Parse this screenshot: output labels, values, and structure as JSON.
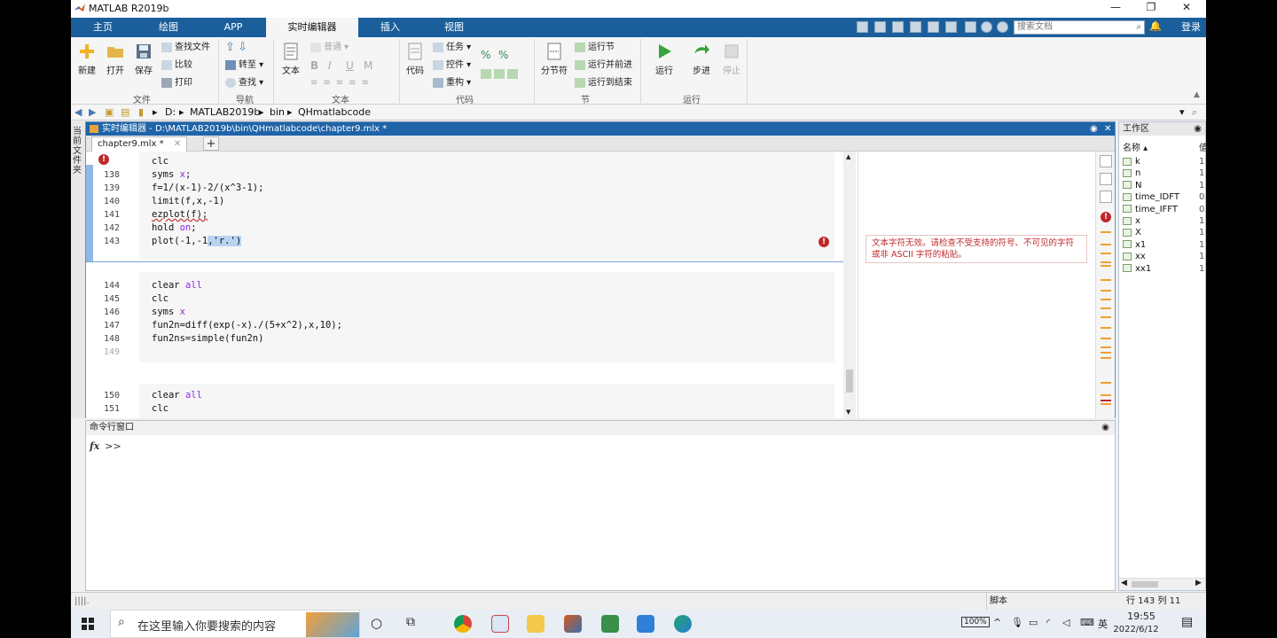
{
  "window": {
    "title": "MATLAB R2019b",
    "controls": [
      "—",
      "❐",
      "✕"
    ]
  },
  "tabs": [
    "主页",
    "绘图",
    "APP",
    "实时编辑器",
    "插入",
    "视图"
  ],
  "search": {
    "placeholder": "搜索文档"
  },
  "login": "登录",
  "ribbon": {
    "file": {
      "new": "新建",
      "open": "打开",
      "save": "保存",
      "find_files": "查找文件",
      "compare": "比较",
      "print": "打印",
      "label": "文件"
    },
    "nav": {
      "goto": "转至",
      "find": "查找",
      "label": "导航"
    },
    "text": {
      "text_btn": "文本",
      "normal": "普通",
      "bold": "B",
      "italic": "I",
      "underline": "U",
      "mono": "M",
      "label": "文本"
    },
    "code": {
      "code_btn": "代码",
      "task": "任务",
      "control": "控件",
      "refactor": "重构",
      "label": "代码"
    },
    "section": {
      "section_break": "分节符",
      "run_section": "运行节",
      "run_advance": "运行并前进",
      "run_to_end": "运行到结束",
      "label": "节"
    },
    "run": {
      "run": "运行",
      "step": "步进",
      "stop": "停止",
      "label": "运行"
    }
  },
  "address": {
    "drive": "D:",
    "parts": [
      "MATLAB2019b",
      "bin",
      "QHmatlabcode"
    ]
  },
  "side_panel": {
    "label": "当前文件夹"
  },
  "editor": {
    "header": "实时编辑器 - D:\\MATLAB2019b\\bin\\QHmatlabcode\\chapter9.mlx *",
    "tab": "chapter9.mlx *",
    "block1": {
      "lines": [
        {
          "n": "",
          "code": "clc"
        },
        {
          "n": "138",
          "code": "syms x;"
        },
        {
          "n": "139",
          "code": "f=1/(x-1)-2/(x^3-1);"
        },
        {
          "n": "140",
          "code": "limit(f,x,-1)"
        },
        {
          "n": "141",
          "code": "ezplot(f);"
        },
        {
          "n": "142",
          "code": "hold on;"
        },
        {
          "n": "143",
          "code": "plot(-1,-1,'r.')"
        }
      ]
    },
    "block2": {
      "lines": [
        {
          "n": "144",
          "code": "clear all"
        },
        {
          "n": "145",
          "code": "clc"
        },
        {
          "n": "146",
          "code": "syms x"
        },
        {
          "n": "147",
          "code": "fun2n=diff(exp(-x)./(5+x^2),x,10);"
        },
        {
          "n": "148",
          "code": "fun2ns=simple(fun2n)"
        },
        {
          "n": "149",
          "code": ""
        }
      ]
    },
    "block3": {
      "lines": [
        {
          "n": "150",
          "code": "clear all"
        },
        {
          "n": "151",
          "code": "clc"
        }
      ]
    },
    "error_message": "文本字符无效。请检查不受支持的符号、不可见的字符或非 ASCII 字符的粘贴。"
  },
  "workspace": {
    "title": "工作区",
    "col_name": "名称 ▴",
    "col_value": "值",
    "vars": [
      {
        "name": "k",
        "value": "1"
      },
      {
        "name": "n",
        "value": "1"
      },
      {
        "name": "N",
        "value": "1"
      },
      {
        "name": "time_IDFT",
        "value": "0."
      },
      {
        "name": "time_IFFT",
        "value": "0."
      },
      {
        "name": "x",
        "value": "1"
      },
      {
        "name": "X",
        "value": "1"
      },
      {
        "name": "x1",
        "value": "1"
      },
      {
        "name": "xx",
        "value": "1"
      },
      {
        "name": "xx1",
        "value": "1"
      }
    ]
  },
  "command_window": {
    "title": "命令行窗口",
    "fx": "fx",
    "prompt": ">>"
  },
  "status": {
    "left": "||||.",
    "mode": "脚本",
    "position": "行 143  列 11"
  },
  "taskbar": {
    "search": "在这里输入你要搜索的内容",
    "battery": "100%",
    "ime": "英",
    "time": "19:55",
    "date": "2022/6/12"
  },
  "colors": {
    "tab_blue": "#1a5f9c",
    "editor_header": "#1f64a8",
    "error_red": "#c0282b",
    "keyword": "#8a2be2"
  }
}
